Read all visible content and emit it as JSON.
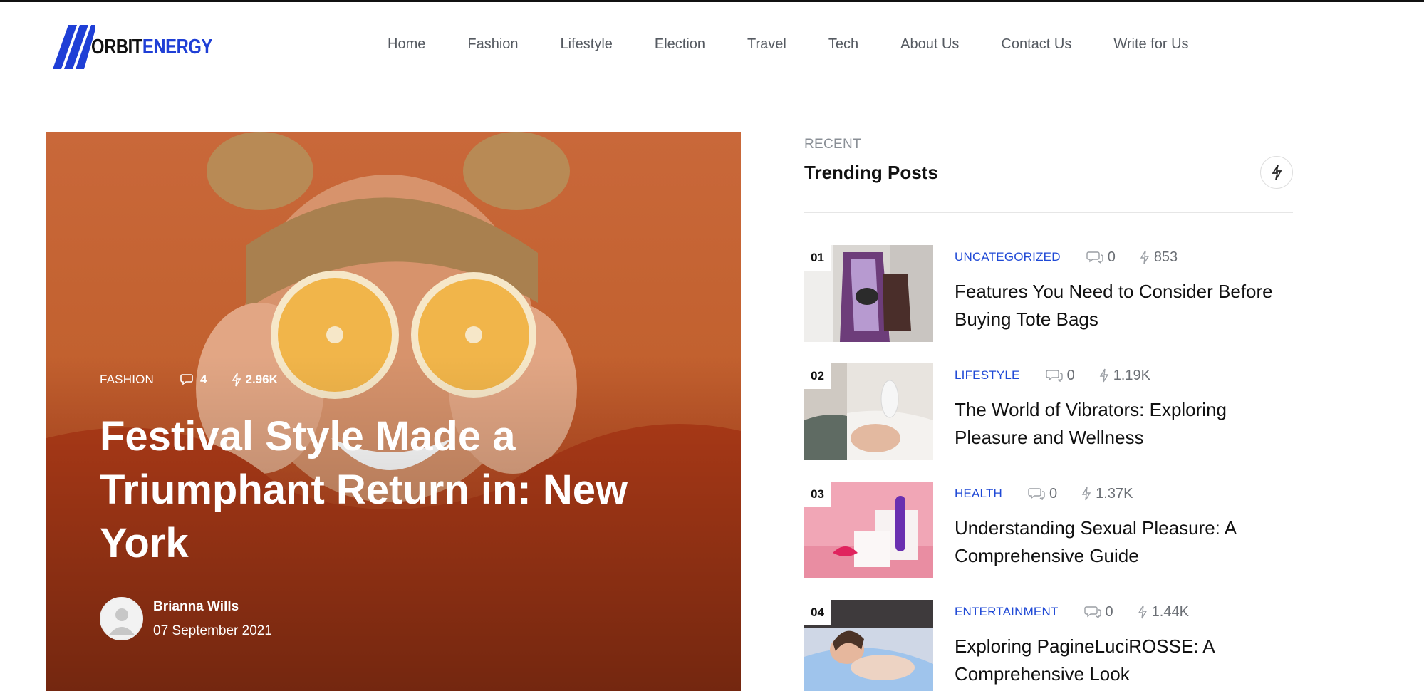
{
  "logo": {
    "part1": "ORBIT",
    "part2": "ENERGY"
  },
  "nav": [
    {
      "label": "Home"
    },
    {
      "label": "Fashion"
    },
    {
      "label": "Lifestyle"
    },
    {
      "label": "Election"
    },
    {
      "label": "Travel"
    },
    {
      "label": "Tech"
    },
    {
      "label": "About Us"
    },
    {
      "label": "Contact Us"
    },
    {
      "label": "Write for Us"
    }
  ],
  "hero": {
    "category": "FASHION",
    "comments": "4",
    "views": "2.96K",
    "title": "Festival Style Made a Triumphant Return in: New York",
    "author": "Brianna Wills",
    "date": "07 September 2021"
  },
  "sidebar": {
    "kicker": "RECENT",
    "heading": "Trending Posts",
    "posts": [
      {
        "rank": "01",
        "category": "UNCATEGORIZED",
        "comments": "0",
        "views": "853",
        "title": "Features You Need to Consider Before Buying Tote Bags"
      },
      {
        "rank": "02",
        "category": "LIFESTYLE",
        "comments": "0",
        "views": "1.19K",
        "title": "The World of Vibrators: Exploring Pleasure and Wellness"
      },
      {
        "rank": "03",
        "category": "HEALTH",
        "comments": "0",
        "views": "1.37K",
        "title": "Understanding Sexual Pleasure: A Comprehensive Guide"
      },
      {
        "rank": "04",
        "category": "ENTERTAINMENT",
        "comments": "0",
        "views": "1.44K",
        "title": "Exploring PagineLuciROSSE: A Comprehensive Look"
      }
    ]
  },
  "colors": {
    "accent": "#1f49d6",
    "logo_blue": "#1f3fd6",
    "hero_bg": "#c2612f"
  }
}
